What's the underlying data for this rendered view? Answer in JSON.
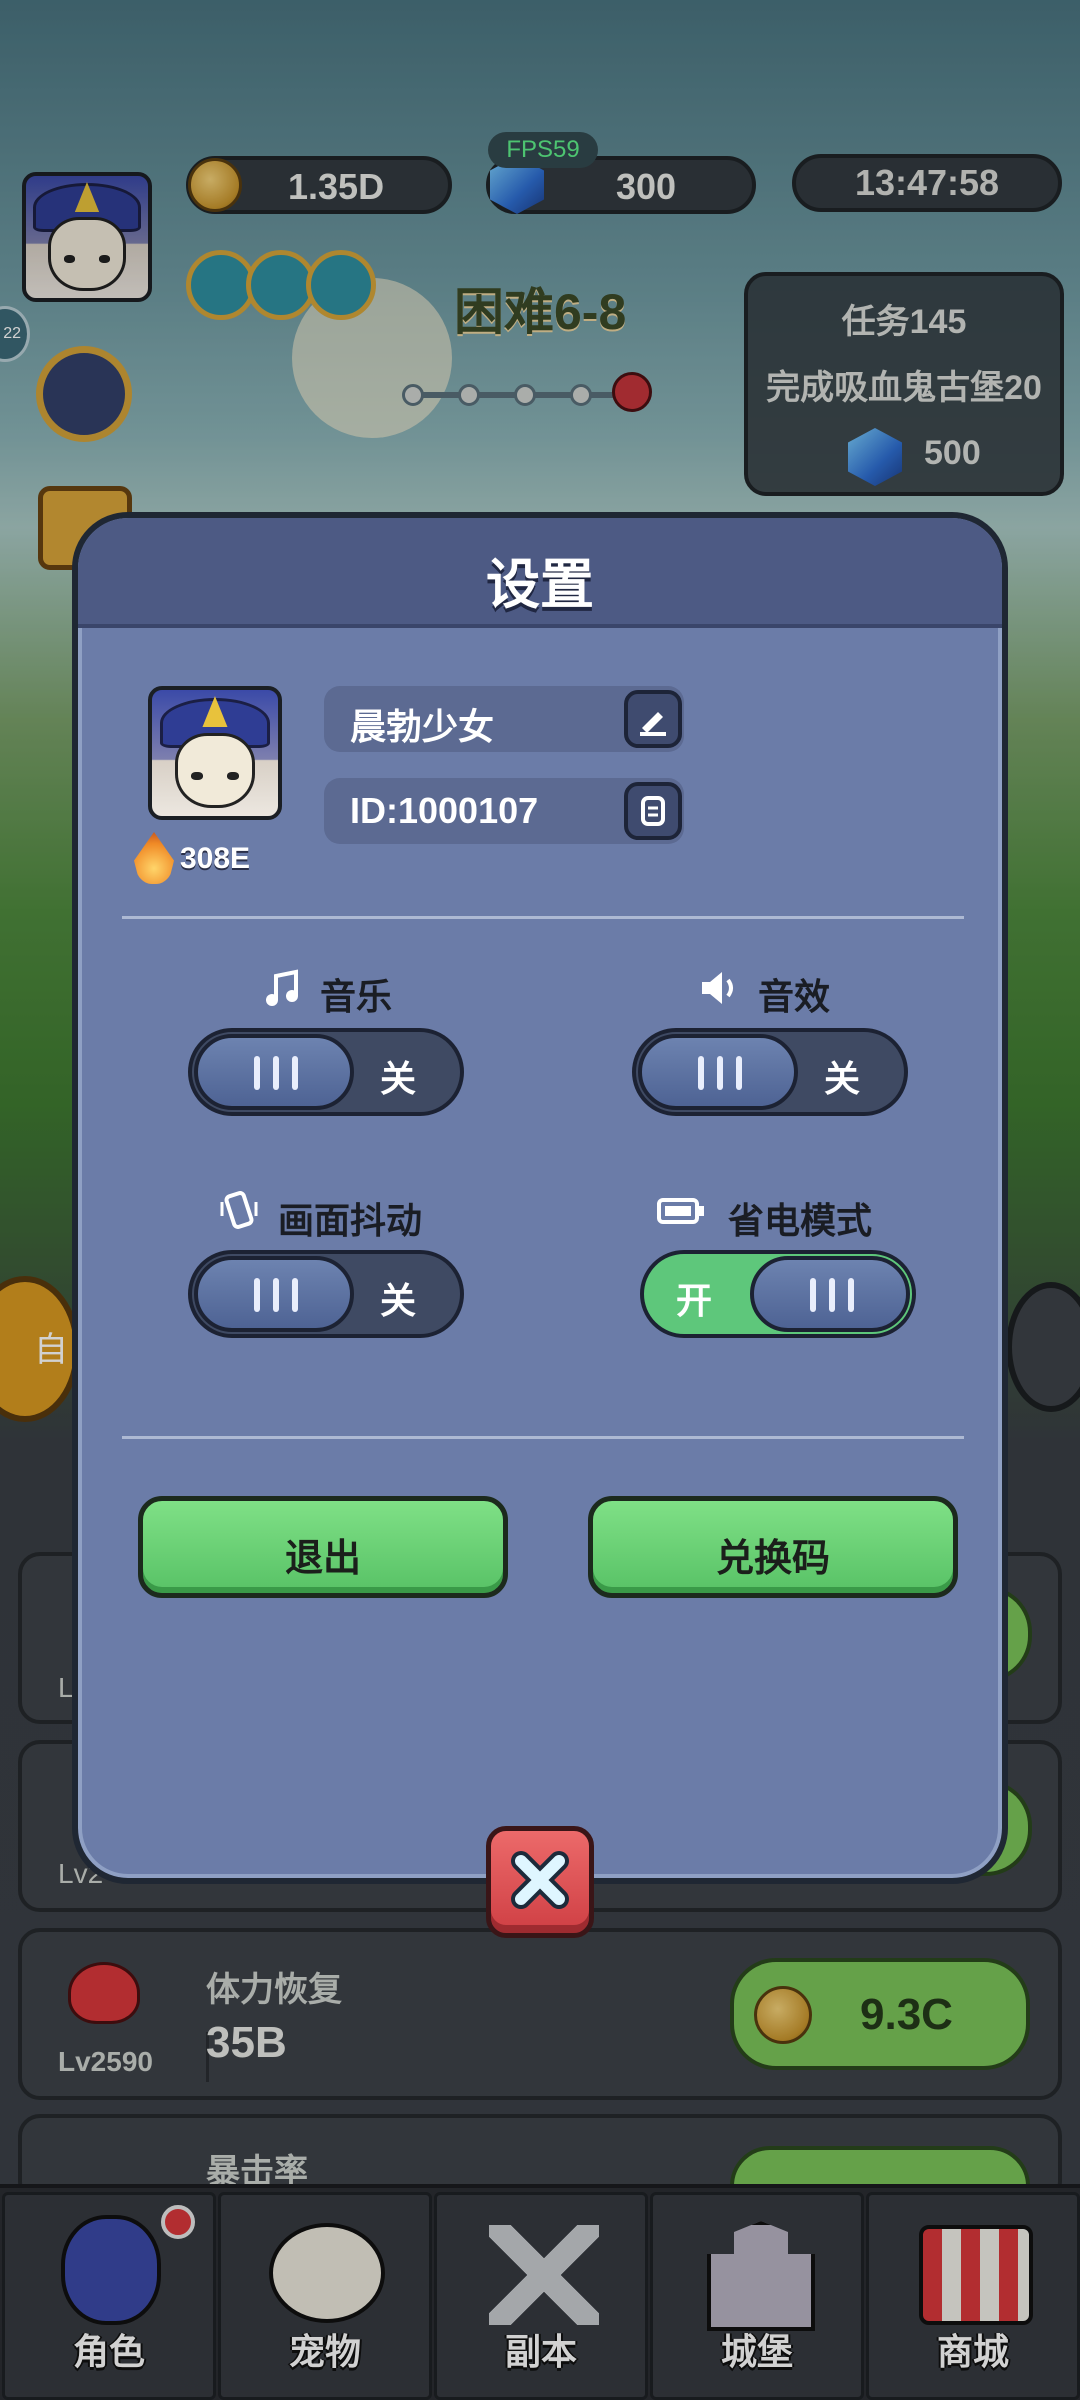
{
  "hud": {
    "coins": "1.35D",
    "gems": "300",
    "fps": "FPS59",
    "clock": "13:47:58",
    "stage": "困难6-8",
    "side_badge": "22"
  },
  "task": {
    "title": "任务145",
    "desc": "完成吸血鬼古堡20",
    "reward": "500"
  },
  "upgrades": [
    {
      "name": "体力恢复",
      "value": "35B",
      "level": "Lv2590",
      "cost": "9.3C"
    },
    {
      "name": "暴击率",
      "value": "",
      "level": "",
      "cost": ""
    }
  ],
  "partial_labels": {
    "card1_level": "Lv",
    "card2_level": "Lv2",
    "side_button": "自"
  },
  "tabs": [
    {
      "label": "角色",
      "icon": "hero-icon"
    },
    {
      "label": "宠物",
      "icon": "panda-icon"
    },
    {
      "label": "副本",
      "icon": "swords-icon"
    },
    {
      "label": "城堡",
      "icon": "castle-icon"
    },
    {
      "label": "商城",
      "icon": "shop-icon"
    }
  ],
  "settings": {
    "title": "设置",
    "nickname": "晨勃少女",
    "user_id": "ID:1000107",
    "power": "308E",
    "music": {
      "label": "音乐",
      "state": "关",
      "on": false
    },
    "sfx": {
      "label": "音效",
      "state": "关",
      "on": false
    },
    "shake": {
      "label": "画面抖动",
      "state": "关",
      "on": false
    },
    "power_save": {
      "label": "省电模式",
      "state": "开",
      "on": true
    },
    "logout_label": "退出",
    "redeem_label": "兑换码"
  },
  "colors": {
    "dialog_bg": "#6b7ca8",
    "dialog_header": "#4d5a84",
    "button_green": "#58c266",
    "close_red": "#cf3f44"
  }
}
